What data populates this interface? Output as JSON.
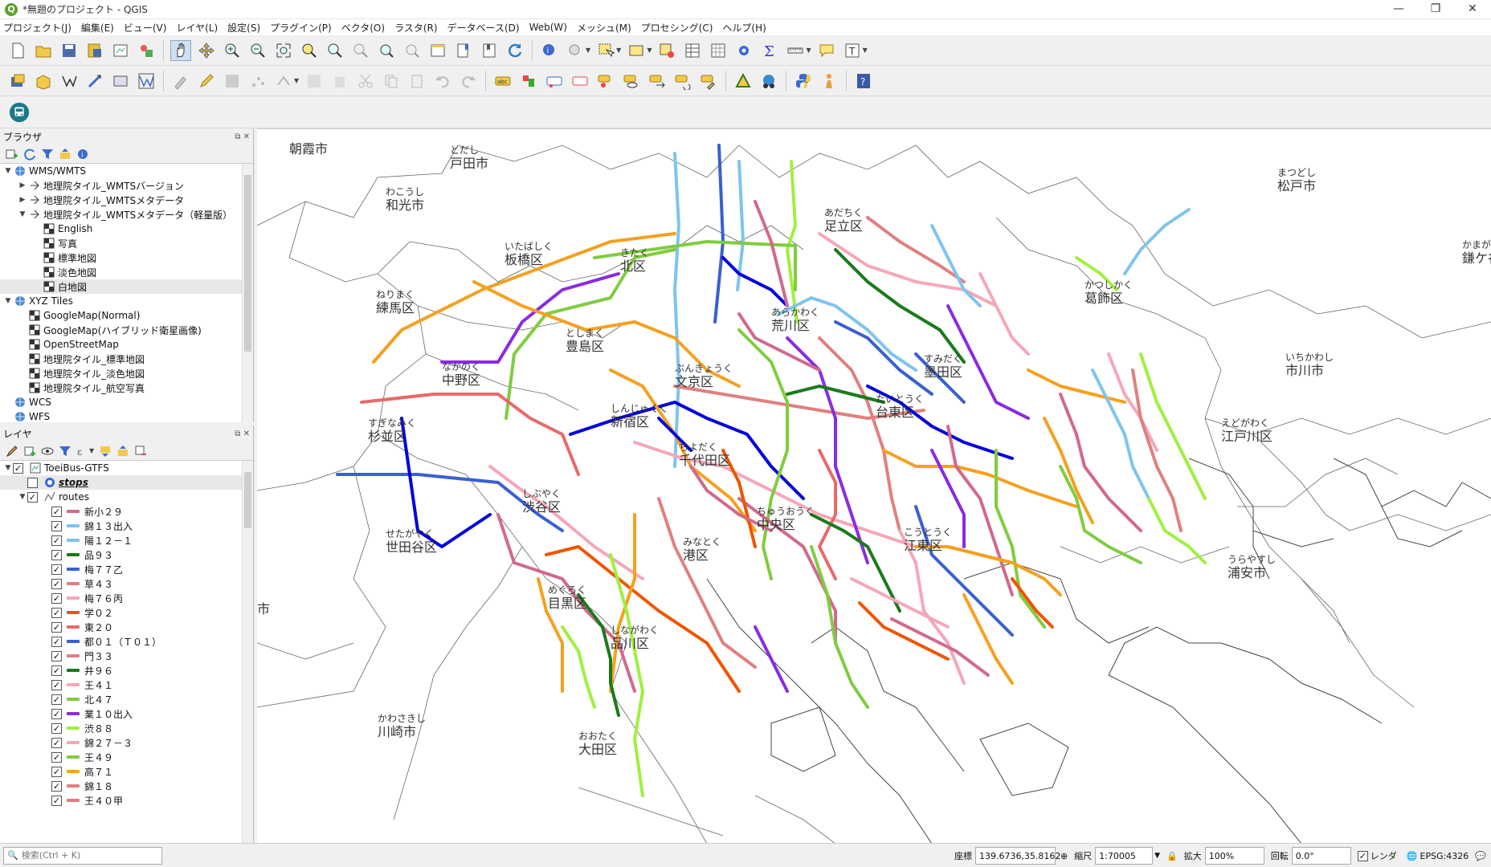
{
  "window": {
    "title": "*無題のプロジェクト - QGIS",
    "controls": [
      "—",
      "❐",
      "✕"
    ]
  },
  "menu": [
    "プロジェクト(J)",
    "編集(E)",
    "ビュー(V)",
    "レイヤ(L)",
    "設定(S)",
    "プラグイン(P)",
    "ベクタ(O)",
    "ラスタ(R)",
    "データベース(D)",
    "Web(W)",
    "メッシュ(M)",
    "プロセシング(C)",
    "ヘルプ(H)"
  ],
  "browser": {
    "title": "ブラウザ",
    "items": [
      {
        "label": "WMS/WMTS",
        "level": 0,
        "arrow": "▼",
        "icon": "globe-icon"
      },
      {
        "label": "地理院タイル_WMTSバージョン",
        "level": 1,
        "arrow": "▶",
        "icon": "wmts-icon"
      },
      {
        "label": "地理院タイル_WMTSメタデータ",
        "level": 1,
        "arrow": "▶",
        "icon": "wmts-icon"
      },
      {
        "label": "地理院タイル_WMTSメタデータ（軽量版）",
        "level": 1,
        "arrow": "▼",
        "icon": "wmts-icon"
      },
      {
        "label": "English",
        "level": 2,
        "arrow": "",
        "icon": "raster-icon"
      },
      {
        "label": "写真",
        "level": 2,
        "arrow": "",
        "icon": "raster-icon"
      },
      {
        "label": "標準地図",
        "level": 2,
        "arrow": "",
        "icon": "raster-icon"
      },
      {
        "label": "淡色地図",
        "level": 2,
        "arrow": "",
        "icon": "raster-icon"
      },
      {
        "label": "白地図",
        "level": 2,
        "arrow": "",
        "icon": "raster-icon",
        "selected": true
      },
      {
        "label": "XYZ Tiles",
        "level": 0,
        "arrow": "▼",
        "icon": "globe-icon"
      },
      {
        "label": "GoogleMap(Normal)",
        "level": 1,
        "arrow": "",
        "icon": "raster-icon"
      },
      {
        "label": "GoogleMap(ハイブリッド衛星画像)",
        "level": 1,
        "arrow": "",
        "icon": "raster-icon"
      },
      {
        "label": "OpenStreetMap",
        "level": 1,
        "arrow": "",
        "icon": "raster-icon"
      },
      {
        "label": "地理院タイル_標準地図",
        "level": 1,
        "arrow": "",
        "icon": "raster-icon"
      },
      {
        "label": "地理院タイル_淡色地図",
        "level": 1,
        "arrow": "",
        "icon": "raster-icon"
      },
      {
        "label": "地理院タイル_航空写真",
        "level": 1,
        "arrow": "",
        "icon": "raster-icon"
      },
      {
        "label": "WCS",
        "level": 0,
        "arrow": "",
        "icon": "globe-icon"
      },
      {
        "label": "WFS",
        "level": 0,
        "arrow": "",
        "icon": "globe-icon"
      }
    ]
  },
  "layers": {
    "title": "レイヤ",
    "group": "ToeiBus-GTFS",
    "stops": "stops",
    "routes": "routes",
    "items": [
      {
        "label": "新小２９",
        "color": "#d06a8e"
      },
      {
        "label": "錦１３出入",
        "color": "#7fc4ee"
      },
      {
        "label": "陽１２－１",
        "color": "#7fc4ee"
      },
      {
        "label": "品９３",
        "color": "#1a7a1a"
      },
      {
        "label": "梅７７乙",
        "color": "#3a5fd0"
      },
      {
        "label": "草４３",
        "color": "#e08080"
      },
      {
        "label": "梅７６丙",
        "color": "#f5a7b8"
      },
      {
        "label": "学０２",
        "color": "#ee5500"
      },
      {
        "label": "東２０",
        "color": "#e86a6a"
      },
      {
        "label": "都０１（Ｔ０１）",
        "color": "#3a5fd0"
      },
      {
        "label": "門３３",
        "color": "#e08080"
      },
      {
        "label": "井９６",
        "color": "#1a7a1a"
      },
      {
        "label": "王４１",
        "color": "#f5a7b8"
      },
      {
        "label": "北４７",
        "color": "#80cc40"
      },
      {
        "label": "業１０出入",
        "color": "#8a2be2"
      },
      {
        "label": "渋８８",
        "color": "#a0f040"
      },
      {
        "label": "錦２７－３",
        "color": "#f5a7b8"
      },
      {
        "label": "王４９",
        "color": "#80cc40"
      },
      {
        "label": "高７１",
        "color": "#f5a020"
      },
      {
        "label": "錦１８",
        "color": "#e08080"
      },
      {
        "label": "王４０甲",
        "color": "#e08080"
      }
    ]
  },
  "map": {
    "labels": [
      {
        "kana": "",
        "name": "朝霞市"
      },
      {
        "kana": "とだし",
        "name": "戸田市"
      },
      {
        "kana": "わこうし",
        "name": "和光市"
      },
      {
        "kana": "いたばしく",
        "name": "板橋区"
      },
      {
        "kana": "ねりまく",
        "name": "練馬区"
      },
      {
        "kana": "きたく",
        "name": "北区"
      },
      {
        "kana": "あだちく",
        "name": "足立区"
      },
      {
        "kana": "まつどし",
        "name": "松戸市"
      },
      {
        "kana": "かまがやし",
        "name": "鎌ケ谷市"
      },
      {
        "kana": "かつしかく",
        "name": "葛飾区"
      },
      {
        "kana": "あらかわく",
        "name": "荒川区"
      },
      {
        "kana": "としまく",
        "name": "豊島区"
      },
      {
        "kana": "なかのく",
        "name": "中野区"
      },
      {
        "kana": "ぶんきょうく",
        "name": "文京区"
      },
      {
        "kana": "すみだく",
        "name": "墨田区"
      },
      {
        "kana": "いちかわし",
        "name": "市川市"
      },
      {
        "kana": "すぎなみく",
        "name": "杉並区"
      },
      {
        "kana": "しんじゅくく",
        "name": "新宿区"
      },
      {
        "kana": "たいとうく",
        "name": "台東区"
      },
      {
        "kana": "えどがわく",
        "name": "江戸川区"
      },
      {
        "kana": "ちよだく",
        "name": "千代田区"
      },
      {
        "kana": "しぶやく",
        "name": "渋谷区"
      },
      {
        "kana": "ちゅうおうく",
        "name": "中央区"
      },
      {
        "kana": "せたがやく",
        "name": "世田谷区"
      },
      {
        "kana": "みなとく",
        "name": "港区"
      },
      {
        "kana": "こうとうく",
        "name": "江東区"
      },
      {
        "kana": "うらやすし",
        "name": "浦安市"
      },
      {
        "kana": "めぐろく",
        "name": "目黒区"
      },
      {
        "kana": "しながわく",
        "name": "品川区"
      },
      {
        "kana": "かわさきし",
        "name": "川崎市"
      },
      {
        "kana": "おおたく",
        "name": "大田区"
      },
      {
        "kana": "",
        "name": "市"
      }
    ]
  },
  "status": {
    "search_placeholder": "検索(Ctrl + K)",
    "coord_label": "座標",
    "coord_value": "139.6736,35.8162",
    "scale_label": "縮尺",
    "scale_value": "1:70005",
    "magnifier_label": "拡大",
    "magnifier_value": "100%",
    "rotation_label": "回転",
    "rotation_value": "0.0°",
    "render_label": "レンダ",
    "crs": "EPSG:4326"
  }
}
